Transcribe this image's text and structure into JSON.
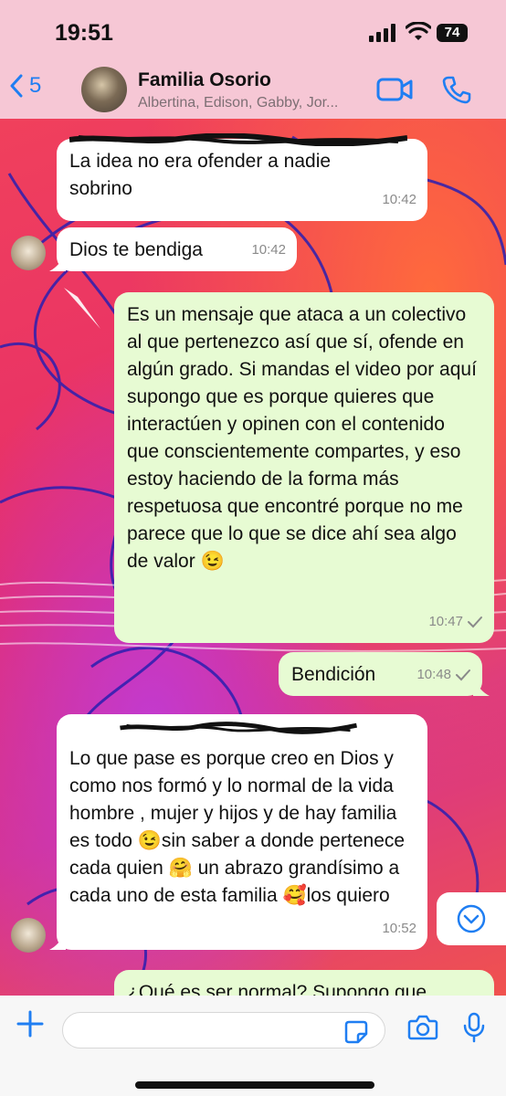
{
  "status_bar": {
    "time": "19:51",
    "battery": "74"
  },
  "header": {
    "back_count": "5",
    "title": "Familia Osorio",
    "subtitle": "Albertina, Edison, Gabby, Jor..."
  },
  "messages": [
    {
      "text": "La idea no era ofender a nadie sobrino",
      "time": "10:42"
    },
    {
      "text": "Dios te bendiga",
      "time": "10:42"
    },
    {
      "text": "Es un mensaje que ataca a un colectivo al que pertenezco así que sí, ofende en algún grado. Si mandas el video por aquí supongo que es porque quieres que interactúen y opinen con el contenido que conscientemente compartes, y eso estoy haciendo de la forma más respetuosa que encontré porque no me parece que lo que se dice ahí sea algo de valor 😉",
      "time": "10:47"
    },
    {
      "text": "Bendición",
      "time": "10:48"
    },
    {
      "text": "Lo que pase es porque creo en Dios y como nos formó y lo normal de la vida hombre , mujer y hijos y de hay familia es todo 😉sin saber a donde pertenece cada quien 🤗 un abrazo grandísimo a cada uno de esta familia 🥰los quiero",
      "time": "10:52"
    },
    {
      "text": "¿Qué es ser normal? Supongo que"
    }
  ],
  "colors": {
    "accent": "#1f7ef2",
    "outgoing_bubble": "#e7fbd3",
    "incoming_bubble": "#ffffff",
    "header_bg": "#f6c7d5"
  },
  "icons": [
    "back-chevron-icon",
    "video-call-icon",
    "phone-icon",
    "plus-icon",
    "sticker-icon",
    "camera-icon",
    "microphone-icon",
    "scroll-down-icon",
    "read-check-icon"
  ]
}
